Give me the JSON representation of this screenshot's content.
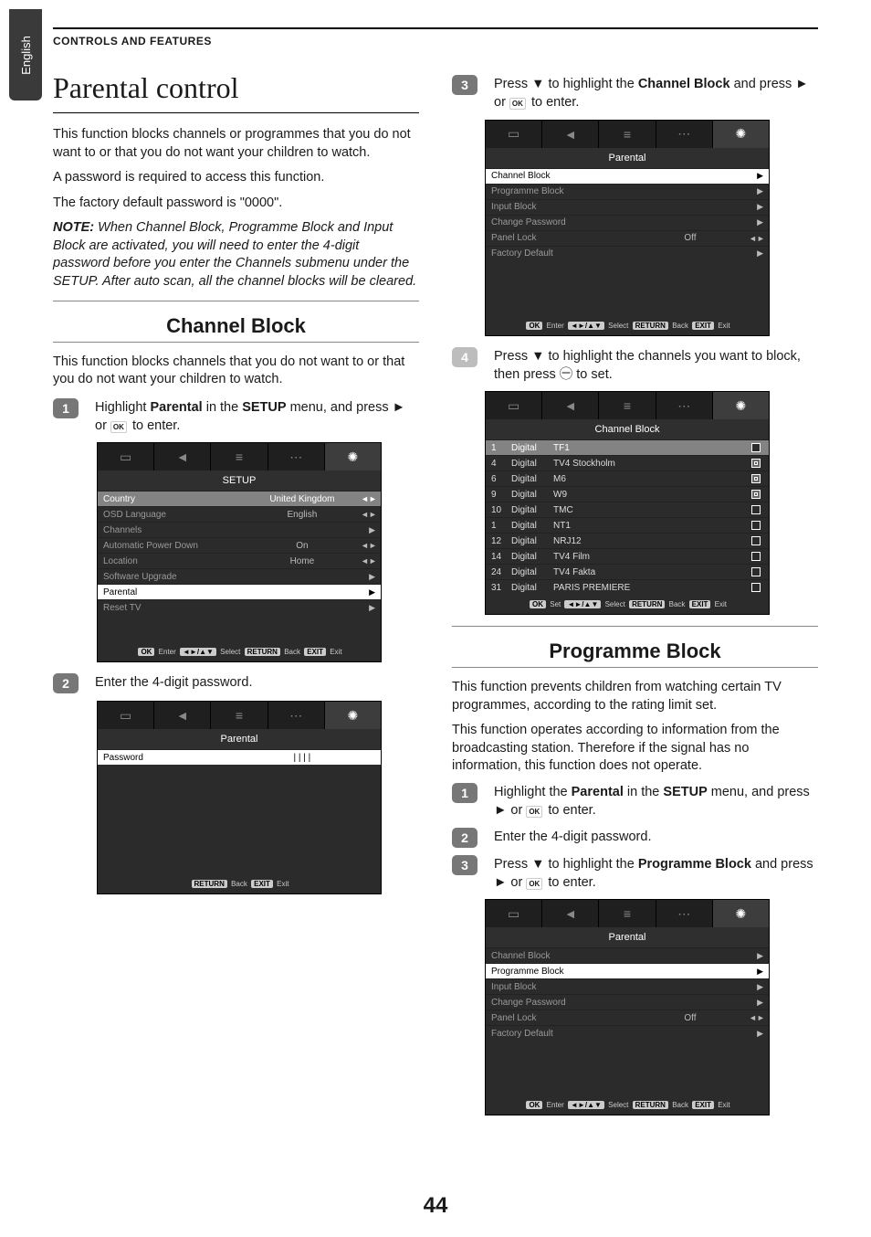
{
  "sideTab": "English",
  "headerLine": "CONTROLS AND FEATURES",
  "pageNumber": "44",
  "left": {
    "h1": "Parental control",
    "intro1": "This function blocks channels or programmes that you do not want to or that you do not want your children to watch.",
    "intro2": "A password is required to access this function.",
    "intro3": "The factory default password is \"0000\".",
    "note": "NOTE: When Channel Block, Programme Block and Input Block are activated, you will need to enter the 4-digit password before you enter the Channels submenu under the SETUP. After auto scan, all the channel blocks will be cleared.",
    "subhead": "Channel Block",
    "subdesc": "This function blocks channels that you do not want to or that you do not want your children to watch.",
    "step1_num": "1",
    "step1_a": "Highlight ",
    "step1_b": "Parental",
    "step1_c": " in the ",
    "step1_d": "SETUP",
    "step1_e": " menu, and press ► or ",
    "step1_f": " to enter.",
    "step2_num": "2",
    "step2_text": "Enter the 4-digit password.",
    "osd1": {
      "title": "SETUP",
      "rows": [
        {
          "label": "Country",
          "val": "United Kingdom",
          "arrow": "◄►",
          "cls": "sel"
        },
        {
          "label": "OSD Language",
          "val": "English",
          "arrow": "◄►"
        },
        {
          "label": "Channels",
          "val": "",
          "arrow": "▶"
        },
        {
          "label": "Automatic Power Down",
          "val": "On",
          "arrow": "◄►"
        },
        {
          "label": "Location",
          "val": "Home",
          "arrow": "◄►"
        },
        {
          "label": "Software Upgrade",
          "val": "",
          "arrow": "▶"
        },
        {
          "label": "Parental",
          "val": "",
          "arrow": "▶",
          "cls": "hl"
        },
        {
          "label": "Reset TV",
          "val": "",
          "arrow": "▶"
        }
      ],
      "hint": {
        "ok": "OK",
        "t1": "Enter",
        "arrows": "◄►/▲▼",
        "t2": "Select",
        "ret": "RETURN",
        "t3": "Back",
        "exit": "EXIT",
        "t4": "Exit"
      }
    },
    "osd2": {
      "title": "Parental",
      "rows": [
        {
          "label": "Password",
          "val": "| | | |",
          "arrow": "",
          "cls": "hl"
        }
      ],
      "hint": {
        "ret": "RETURN",
        "t3": "Back",
        "exit": "EXIT",
        "t4": "Exit"
      }
    }
  },
  "right": {
    "step3_num": "3",
    "step3_a": "Press ▼ to highlight the ",
    "step3_b": "Channel Block",
    "step3_c": " and press ► or ",
    "step3_d": " to enter.",
    "osd3": {
      "title": "Parental",
      "rows": [
        {
          "label": "Channel Block",
          "val": "",
          "arrow": "▶",
          "cls": "hl"
        },
        {
          "label": "Programme Block",
          "val": "",
          "arrow": "▶"
        },
        {
          "label": "Input Block",
          "val": "",
          "arrow": "▶"
        },
        {
          "label": "Change Password",
          "val": "",
          "arrow": "▶"
        },
        {
          "label": "Panel Lock",
          "val": "Off",
          "arrow": "◄►"
        },
        {
          "label": "Factory Default",
          "val": "",
          "arrow": "▶"
        }
      ],
      "hint": {
        "ok": "OK",
        "t1": "Enter",
        "arrows": "◄►/▲▼",
        "t2": "Select",
        "ret": "RETURN",
        "t3": "Back",
        "exit": "EXIT",
        "t4": "Exit"
      }
    },
    "step4_num": "4",
    "step4_text": "Press ▼ to highlight the channels you want to block, then press ㊀ to set.",
    "osd4": {
      "title": "Channel Block",
      "rows": [
        {
          "n": "1",
          "t": "Digital",
          "name": "TF1",
          "chk": "empty",
          "sel": true
        },
        {
          "n": "4",
          "t": "Digital",
          "name": "TV4 Stockholm",
          "chk": "lock"
        },
        {
          "n": "6",
          "t": "Digital",
          "name": "M6",
          "chk": "lock"
        },
        {
          "n": "9",
          "t": "Digital",
          "name": "W9",
          "chk": "lock"
        },
        {
          "n": "10",
          "t": "Digital",
          "name": "TMC",
          "chk": "empty"
        },
        {
          "n": "1",
          "t": "Digital",
          "name": "NT1",
          "chk": "empty"
        },
        {
          "n": "12",
          "t": "Digital",
          "name": "NRJ12",
          "chk": "empty"
        },
        {
          "n": "14",
          "t": "Digital",
          "name": "TV4 Film",
          "chk": "empty"
        },
        {
          "n": "24",
          "t": "Digital",
          "name": "TV4 Fakta",
          "chk": "empty"
        },
        {
          "n": "31",
          "t": "Digital",
          "name": "PARIS PREMIERE",
          "chk": "empty"
        }
      ],
      "hint": {
        "ok": "OK",
        "t1": "Set",
        "arrows": "◄►/▲▼",
        "t2": "Select",
        "ret": "RETURN",
        "t3": "Back",
        "exit": "EXIT",
        "t4": "Exit"
      }
    },
    "subhead2": "Programme Block",
    "pb_p1": "This function prevents children from watching certain TV programmes, according to the rating limit set.",
    "pb_p2": "This function operates according to information from the broadcasting station. Therefore if the signal has no information, this function does not operate.",
    "pb_s1_num": "1",
    "pb_s1_a": "Highlight the ",
    "pb_s1_b": "Parental",
    "pb_s1_c": " in the ",
    "pb_s1_d": "SETUP",
    "pb_s1_e": " menu, and press ► or ",
    "pb_s1_f": " to enter.",
    "pb_s2_num": "2",
    "pb_s2": "Enter the 4-digit password.",
    "pb_s3_num": "3",
    "pb_s3_a": "Press ▼ to highlight the ",
    "pb_s3_b": "Programme Block",
    "pb_s3_c": " and press ► or ",
    "pb_s3_d": " to enter.",
    "osd5": {
      "title": "Parental",
      "rows": [
        {
          "label": "Channel Block",
          "val": "",
          "arrow": "▶"
        },
        {
          "label": "Programme Block",
          "val": "",
          "arrow": "▶",
          "cls": "hl"
        },
        {
          "label": "Input Block",
          "val": "",
          "arrow": "▶"
        },
        {
          "label": "Change Password",
          "val": "",
          "arrow": "▶"
        },
        {
          "label": "Panel Lock",
          "val": "Off",
          "arrow": "◄►"
        },
        {
          "label": "Factory Default",
          "val": "",
          "arrow": "▶"
        }
      ],
      "hint": {
        "ok": "OK",
        "t1": "Enter",
        "arrows": "◄►/▲▼",
        "t2": "Select",
        "ret": "RETURN",
        "t3": "Back",
        "exit": "EXIT",
        "t4": "Exit"
      }
    }
  },
  "icons": {
    "picture": "▭",
    "sound": "◄",
    "app": "≡",
    "preference": "⋯",
    "setup": "✺"
  }
}
